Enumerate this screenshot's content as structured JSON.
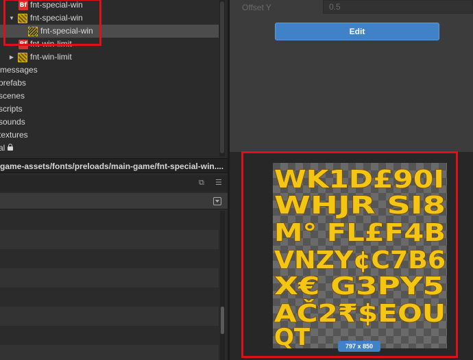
{
  "tree": {
    "items": [
      {
        "label": "fnt-special-win",
        "icon": "bitmap-font-icon"
      },
      {
        "label": "fnt-special-win",
        "icon": "sprite-atlas-icon",
        "expanded": true
      },
      {
        "label": "fnt-special-win",
        "icon": "sprite-frame-icon",
        "selected": true
      },
      {
        "label": "fnt-win-limit",
        "icon": "bitmap-font-icon"
      },
      {
        "label": "fnt-win-limit",
        "icon": "sprite-atlas-icon",
        "expanded": false
      },
      {
        "label": "messages"
      },
      {
        "label": "prefabs"
      },
      {
        "label": "scenes"
      },
      {
        "label": "scripts"
      },
      {
        "label": "sounds"
      },
      {
        "label": "textures"
      },
      {
        "label": "al"
      }
    ],
    "bf_icon_text": "Bf"
  },
  "path_bar": {
    "text": "game-assets/fonts/preloads/main-game/fnt-special-win...."
  },
  "inspector": {
    "offset_y_label": "Offset Y",
    "offset_y_value": "0.5",
    "edit_label": "Edit"
  },
  "preview": {
    "size_label": "797 x 850",
    "glyph_rows": [
      "WK1D£90I",
      "WHJR SI8",
      "M° FL£F4B",
      "VNZY¢C7B6",
      "X€ G3PY5",
      "AČ2₹$EOU",
      "QT"
    ]
  },
  "colors": {
    "selection": "#4c4c4c",
    "accent": "#3f82c8",
    "highlight": "#e0101a",
    "glyph": "#f3c514"
  }
}
